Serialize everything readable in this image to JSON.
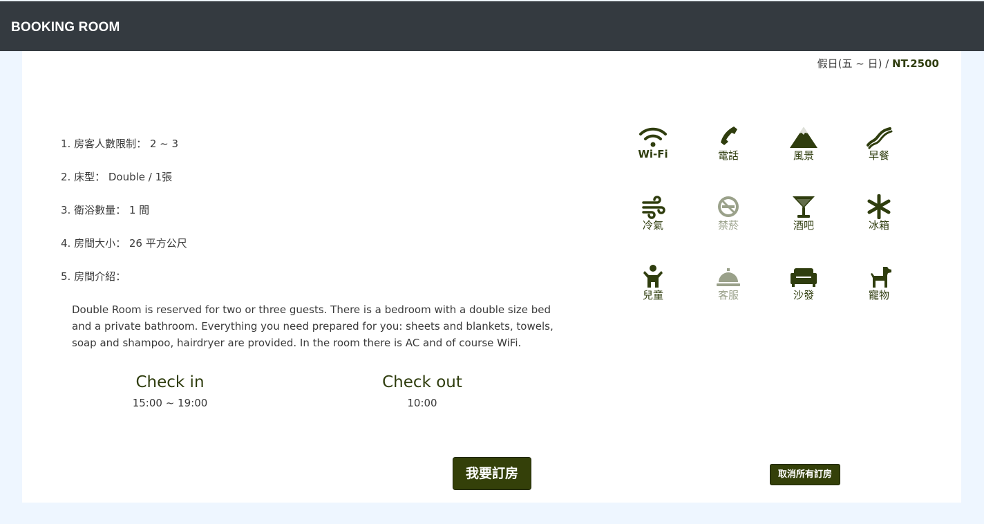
{
  "header": {
    "brand": "BOOKING ROOM"
  },
  "room": {
    "price_label": "假日(五 ~ 日) / ",
    "price_amount": "NT.2500",
    "specs": [
      "1. 房客人數限制： 2 ~ 3",
      "2. 床型： Double / 1張",
      "3. 衛浴數量： 1 間",
      "4. 房間大小： 26 平方公尺",
      "5. 房間介紹："
    ],
    "description": "Double Room is reserved for two or three guests. There is a bedroom with a double size bed and a private bathroom. Everything you need prepared for you: sheets and blankets, towels, soap and shampoo, hairdryer are provided. In the room there is AC and of course WiFi.",
    "check_in": {
      "title": "Check in",
      "time": "15:00 ~ 19:00"
    },
    "check_out": {
      "title": "Check out",
      "time": "10:00"
    }
  },
  "amenities": [
    {
      "label": "Wi-Fi",
      "icon": "wifi-icon",
      "available": true
    },
    {
      "label": "電話",
      "icon": "phone-icon",
      "available": true
    },
    {
      "label": "風景",
      "icon": "mountain-icon",
      "available": true
    },
    {
      "label": "早餐",
      "icon": "bacon-icon",
      "available": true
    },
    {
      "label": "冷氣",
      "icon": "wind-icon",
      "available": true
    },
    {
      "label": "禁菸",
      "icon": "no-smoking-icon",
      "available": false
    },
    {
      "label": "酒吧",
      "icon": "cocktail-icon",
      "available": true
    },
    {
      "label": "冰箱",
      "icon": "snowflake-icon",
      "available": true
    },
    {
      "label": "兒童",
      "icon": "child-icon",
      "available": true
    },
    {
      "label": "客服",
      "icon": "concierge-bell-icon",
      "available": false
    },
    {
      "label": "沙發",
      "icon": "couch-icon",
      "available": true
    },
    {
      "label": "寵物",
      "icon": "dog-icon",
      "available": true
    }
  ],
  "actions": {
    "book": "我要訂房",
    "cancel_all": "取消所有訂房"
  },
  "colors": {
    "navbar": "#343a40",
    "accent": "#344009",
    "disabled": "#9aa18a",
    "page_bg": "#eef6ff"
  }
}
